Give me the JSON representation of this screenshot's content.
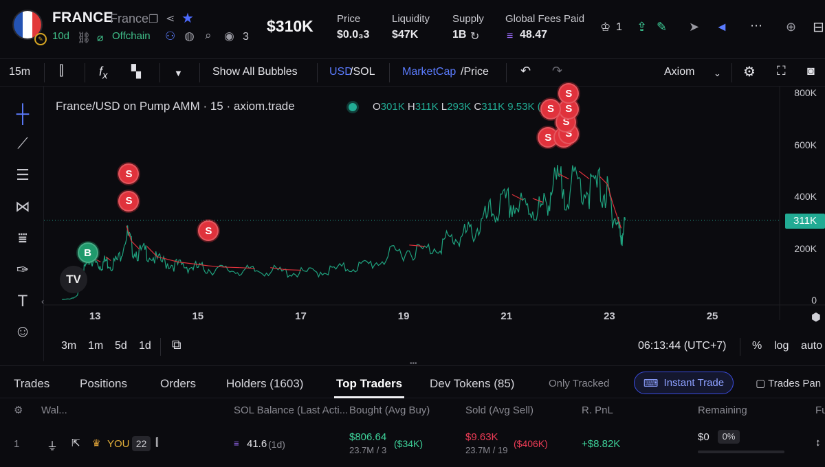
{
  "header": {
    "ticker": "FRANCE",
    "name": "France",
    "age": "10d",
    "offchain": "Offchain",
    "watchers": "3",
    "market_cap": "$310K",
    "stats": [
      {
        "label": "Price",
        "value": "$0.0₃3"
      },
      {
        "label": "Liquidity",
        "value": "$47K"
      },
      {
        "label": "Supply",
        "value": "1B"
      },
      {
        "label": "Global Fees Paid",
        "value": "48.47"
      }
    ],
    "crown_count": "1",
    "flag_colors": [
      "#2453b3",
      "#ffffff",
      "#e23a3a"
    ]
  },
  "toolbar": {
    "interval": "15m",
    "show_bubbles": "Show All Bubbles",
    "usd": "USD",
    "sol": "/SOL",
    "marketcap": "MarketCap",
    "price": "/Price",
    "provider": "Axiom"
  },
  "chart_data": {
    "type": "line",
    "title": "France/USD on Pump AMM · 15 · axiom.trade",
    "ohlc": {
      "o": "301K",
      "h": "311K",
      "l": "293K",
      "c": "311K",
      "change": "9.53K (+3.16"
    },
    "x_ticks": [
      "13",
      "15",
      "17",
      "19",
      "21",
      "23",
      "25"
    ],
    "y_ticks": [
      "0",
      "200K",
      "400K",
      "600K",
      "800K"
    ],
    "ylim": [
      0,
      800000
    ],
    "xlim": [
      12.0,
      26.3
    ],
    "last_price_label": "311K",
    "last_price": 311000,
    "series": [
      {
        "values": [
          [
            12.35,
            5000
          ],
          [
            12.5,
            8000
          ],
          [
            12.65,
            20000
          ],
          [
            12.72,
            90000
          ],
          [
            12.8,
            140000
          ],
          [
            12.9,
            180000
          ],
          [
            13.0,
            160000
          ],
          [
            13.1,
            150000
          ],
          [
            13.2,
            170000
          ],
          [
            13.3,
            155000
          ],
          [
            13.45,
            175000
          ],
          [
            13.6,
            290000
          ],
          [
            13.7,
            230000
          ],
          [
            13.85,
            200000
          ],
          [
            14.0,
            210000
          ],
          [
            14.2,
            170000
          ],
          [
            14.4,
            160000
          ],
          [
            14.6,
            150000
          ],
          [
            14.8,
            145000
          ],
          [
            15.0,
            140000
          ],
          [
            15.2,
            135000
          ],
          [
            15.5,
            130000
          ],
          [
            15.8,
            128000
          ],
          [
            16.1,
            125000
          ],
          [
            16.4,
            128000
          ],
          [
            16.7,
            120000
          ],
          [
            17.0,
            118000
          ],
          [
            17.3,
            122000
          ],
          [
            17.6,
            130000
          ],
          [
            17.9,
            140000
          ],
          [
            18.2,
            148000
          ],
          [
            18.5,
            165000
          ],
          [
            18.8,
            200000
          ],
          [
            19.1,
            215000
          ],
          [
            19.4,
            210000
          ],
          [
            19.7,
            240000
          ],
          [
            19.9,
            260000
          ],
          [
            20.1,
            270000
          ],
          [
            20.3,
            290000
          ],
          [
            20.5,
            320000
          ],
          [
            20.7,
            370000
          ],
          [
            20.9,
            400000
          ],
          [
            21.1,
            410000
          ],
          [
            21.3,
            390000
          ],
          [
            21.5,
            395000
          ],
          [
            21.7,
            380000
          ],
          [
            21.85,
            470000
          ],
          [
            22.0,
            490000
          ],
          [
            22.2,
            470000
          ],
          [
            22.4,
            500000
          ],
          [
            22.6,
            470000
          ],
          [
            22.8,
            480000
          ],
          [
            22.95,
            450000
          ],
          [
            23.05,
            380000
          ],
          [
            23.15,
            320000
          ],
          [
            23.22,
            280000
          ],
          [
            23.3,
            311000
          ]
        ]
      }
    ],
    "markers": [
      {
        "kind": "S",
        "x": 13.65,
        "y": 490000
      },
      {
        "kind": "S",
        "x": 13.65,
        "y": 385000
      },
      {
        "kind": "S",
        "x": 15.2,
        "y": 270000
      },
      {
        "kind": "B",
        "x": 12.85,
        "y": 185000
      },
      {
        "kind": "S",
        "x": 21.8,
        "y": 630000
      },
      {
        "kind": "S",
        "x": 22.1,
        "y": 630000
      },
      {
        "kind": "S",
        "x": 22.2,
        "y": 645000
      },
      {
        "kind": "S",
        "x": 22.15,
        "y": 690000
      },
      {
        "kind": "S",
        "x": 22.2,
        "y": 740000
      },
      {
        "kind": "S",
        "x": 21.85,
        "y": 740000
      },
      {
        "kind": "S",
        "x": 22.2,
        "y": 800000
      }
    ]
  },
  "chart_bar": {
    "ranges": [
      "3m",
      "1m",
      "5d",
      "1d"
    ],
    "time": "06:13:44 (UTC+7)",
    "pct": "%",
    "log": "log",
    "auto": "auto"
  },
  "tabs": {
    "items": [
      "Trades",
      "Positions",
      "Orders",
      "Holders (1603)",
      "Top Traders",
      "Dev Tokens (85)"
    ],
    "only_tracked": "Only Tracked",
    "instant_trade": "Instant Trade",
    "trades_panel": "Trades Pan"
  },
  "table": {
    "headers": [
      "Wal...",
      "SOL Balance (Last Acti...",
      "Bought (Avg Buy)",
      "Sold (Avg Sell)",
      "R. PnL",
      "Remaining",
      "Fu"
    ],
    "rows": [
      {
        "rank": "1",
        "wallet": "YOU",
        "badge": "22",
        "sol_balance": "41.6",
        "sol_age": "(1d)",
        "bought": "$806.64",
        "bought_sub": "23.7M / 3",
        "bought_avg": "($34K)",
        "sold": "$9.63K",
        "sold_sub": "23.7M / 19",
        "sold_avg": "($406K)",
        "pnl": "+$8.82K",
        "remaining": "$0",
        "remaining_pct": "0%"
      }
    ]
  }
}
